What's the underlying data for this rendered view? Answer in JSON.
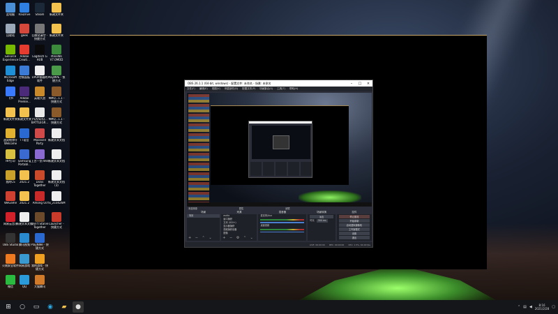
{
  "desktop": {
    "icons": [
      {
        "label": "此电脑",
        "color": "#4a8fd6"
      },
      {
        "label": "RaiDrive",
        "color": "#2f7fe0"
      },
      {
        "label": "Steam",
        "color": "#1b2838"
      },
      {
        "label": "新建文件夹",
        "color": "#f2c14e"
      },
      {
        "label": "回收站",
        "color": "#9aa8b8"
      },
      {
        "label": "geek",
        "color": "#d4473b"
      },
      {
        "label": "回收站清空 - 快捷方式",
        "color": "#777"
      },
      {
        "label": "新建文件夹",
        "color": "#f2c14e"
      },
      {
        "label": "GeForce Experience",
        "color": "#76b900"
      },
      {
        "label": "Adobe Creati...",
        "color": "#e63c2f"
      },
      {
        "label": "Logitech G HUB",
        "color": "#0a0a0a"
      },
      {
        "label": "MineWe V7.0MOD",
        "color": "#3c8a3c"
      },
      {
        "label": "Microsoft Edge",
        "color": "#1e8fd6"
      },
      {
        "label": "控制面板",
        "color": "#3b7bd6"
      },
      {
        "label": "UPUP装载的软件",
        "color": "#eeeeee"
      },
      {
        "label": "PlayMPE - 快捷方式",
        "color": "#4a9a4a"
      },
      {
        "label": "飞书",
        "color": "#3a7afe"
      },
      {
        "label": "Adobe Premie...",
        "color": "#4b2a7a"
      },
      {
        "label": "英雄大战",
        "color": "#c88a2a"
      },
      {
        "label": "MMO...1.1 - 快捷方式",
        "color": "#8a5a2a"
      },
      {
        "label": "新建文件夹",
        "color": "#f2c14e"
      },
      {
        "label": "新建文件夹",
        "color": "#f2c14e"
      },
      {
        "label": "PLAYERU... BATTLEGR...",
        "color": "#e8e8e8"
      },
      {
        "label": "MMO...1.1 - 快捷方式",
        "color": "#8a5a2a"
      },
      {
        "label": "战双帕弥什 Welcome",
        "color": "#e0b030"
      },
      {
        "label": "TT语音",
        "color": "#2a6ad0"
      },
      {
        "label": "Moonsell Party",
        "color": "#d04a4a"
      },
      {
        "label": "新建文本文档",
        "color": "#eeeeee"
      },
      {
        "label": "HP打印",
        "color": "#d8c040"
      },
      {
        "label": "Samsung Portabl...",
        "color": "#3a6ad0"
      },
      {
        "label": "上古一剑 Win",
        "color": "#8a6ad0"
      },
      {
        "label": "新建文本文档",
        "color": "#eeeeee"
      },
      {
        "label": "我的CS",
        "color": "#c8a02a"
      },
      {
        "label": "2021.2",
        "color": "#f2c14e"
      },
      {
        "label": "Dicks Together",
        "color": "#c84a2a"
      },
      {
        "label": "新建文本文档 (3)",
        "color": "#eeeeee"
      },
      {
        "label": "WeGame",
        "color": "#d04030"
      },
      {
        "label": "2021.2",
        "color": "#f2c14e"
      },
      {
        "label": "Among Us",
        "color": "#c82a2a"
      },
      {
        "label": "fix_210426MP",
        "color": "#eeeeee"
      },
      {
        "label": "网易云音乐",
        "color": "#d0202a"
      },
      {
        "label": "新建文本文档",
        "color": "#eeeeee"
      },
      {
        "label": "Don't Starve Together",
        "color": "#6a4a2a"
      },
      {
        "label": "Launcher - 快捷方式",
        "color": "#c83a2a"
      },
      {
        "label": "OBS Studio",
        "color": "#333333"
      },
      {
        "label": "腾讯视频",
        "color": "#2a8ad0"
      },
      {
        "label": "PlayNWe - 快捷方式",
        "color": "#2a6ad0"
      },
      {
        "label": "",
        "color": "transparent"
      },
      {
        "label": "火绒安全软件",
        "color": "#f07a20"
      },
      {
        "label": "网易游戏",
        "color": "#3a9ad0"
      },
      {
        "label": "我的游戏 - 快捷方式",
        "color": "#f0a020"
      },
      {
        "label": "",
        "color": "transparent"
      },
      {
        "label": "微信",
        "color": "#2aba40"
      },
      {
        "label": "QQ",
        "color": "#2a9ad8"
      },
      {
        "label": "大猫腾讯",
        "color": "#d07a2a"
      },
      {
        "label": "",
        "color": "transparent"
      }
    ]
  },
  "obs": {
    "title": "OBS 26.1.1 (64-bit, windows) - 配置文件: 未命名 - 场景: 未命名",
    "menu": [
      "文件(F)",
      "编辑(E)",
      "视图(V)",
      "停靠部件(D)",
      "配置文件(P)",
      "场景集合(S)",
      "工具(T)",
      "帮助(H)"
    ],
    "scene_bar": [
      "未选择源",
      "属性",
      "滤镜"
    ],
    "docks": {
      "scenes": {
        "title": "场景",
        "items": [
          "场景"
        ]
      },
      "sources": {
        "title": "来源",
        "items": [
          "audio",
          "窗口捕获",
          "文本 (GDI+)",
          "显示器捕获",
          "视频捕获设备",
          "图像"
        ]
      },
      "mixer": {
        "title": "混音器",
        "channels": [
          "麦克风/Aux",
          "桌面音频"
        ]
      },
      "transitions": {
        "title": "场景转换",
        "mode": "淡出",
        "duration_label": "时长",
        "duration": "300 ms"
      },
      "controls": {
        "title": "控件",
        "buttons": [
          "停止推流",
          "开始录制",
          "启动虚拟摄像机",
          "工作室模式",
          "设置",
          "退出"
        ]
      }
    },
    "status": [
      "LIVE: 00:00:00",
      "REC: 00:00:00",
      "CPU: 1.5%, 60.00 fps"
    ]
  },
  "taskbar": {
    "start_icon": "windows-icon",
    "pinned": [
      "search-icon",
      "task-view-icon",
      "edge-icon",
      "explorer-icon",
      "obs-icon"
    ],
    "clock_time": "8:16",
    "clock_date": "2021/2/28"
  }
}
